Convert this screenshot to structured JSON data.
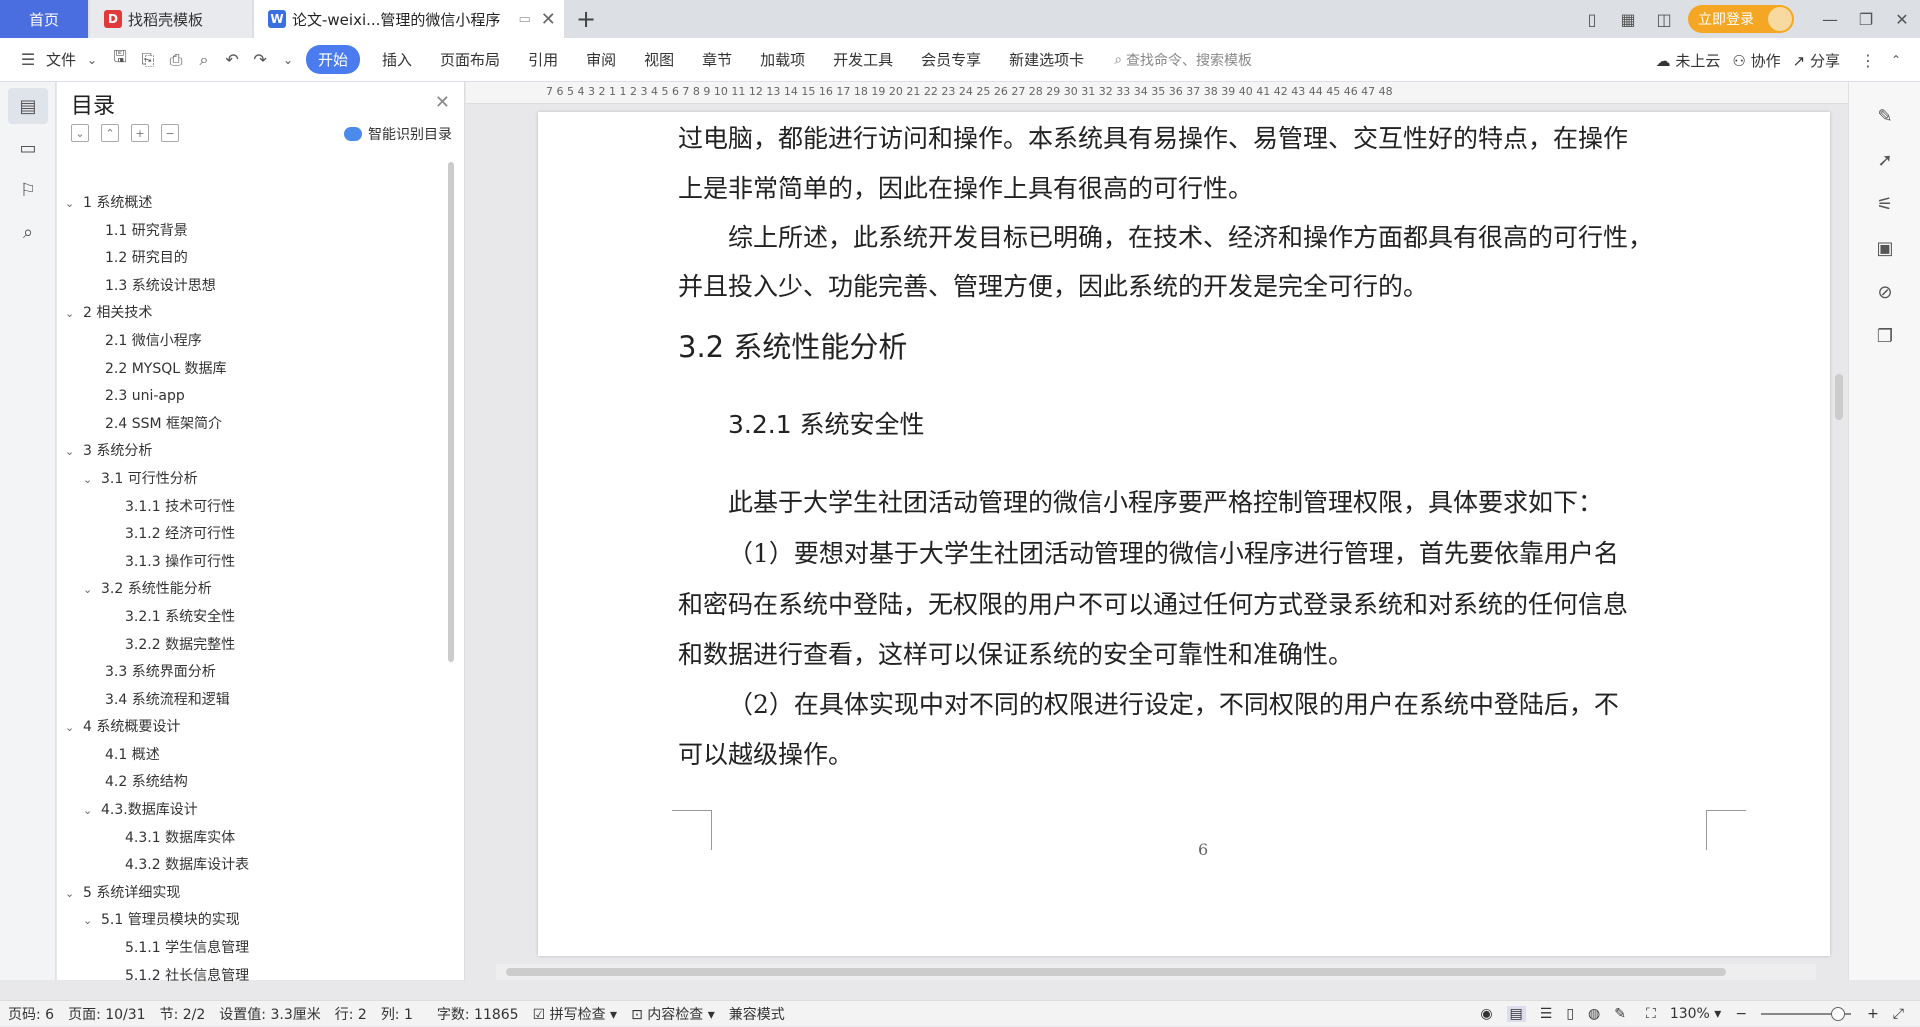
{
  "tabs": {
    "home": "首页",
    "daoke": "找稻壳模板",
    "doc": "论文-weixi...管理的微信小程序",
    "login": "立即登录"
  },
  "menu": {
    "file": "文件",
    "items": [
      "开始",
      "插入",
      "页面布局",
      "引用",
      "审阅",
      "视图",
      "章节",
      "加载项",
      "开发工具",
      "会员专享",
      "新建选项卡"
    ],
    "search_placeholder": "查找命令、搜索模板",
    "cloud": "未上云",
    "collab": "协作",
    "share": "分享"
  },
  "toc": {
    "title": "目录",
    "ai": "智能识别目录",
    "items": [
      {
        "level": 1,
        "exp": true,
        "text": "1 系统概述"
      },
      {
        "level": 2,
        "exp": false,
        "text": "1.1  研究背景"
      },
      {
        "level": 2,
        "exp": false,
        "text": "1.2 研究目的"
      },
      {
        "level": 2,
        "exp": false,
        "text": "1.3 系统设计思想"
      },
      {
        "level": 1,
        "exp": true,
        "text": "2 相关技术"
      },
      {
        "level": 2,
        "exp": false,
        "text": "2.1 微信小程序"
      },
      {
        "level": 2,
        "exp": false,
        "text": "2.2 MYSQL 数据库"
      },
      {
        "level": 2,
        "exp": false,
        "text": "2.3 uni-app"
      },
      {
        "level": 2,
        "exp": false,
        "text": "2.4 SSM 框架简介"
      },
      {
        "level": 1,
        "exp": true,
        "text": "3 系统分析"
      },
      {
        "level": 2,
        "exp": true,
        "text": "3.1 可行性分析"
      },
      {
        "level": 3,
        "exp": false,
        "text": "3.1.1 技术可行性"
      },
      {
        "level": 3,
        "exp": false,
        "text": "3.1.2 经济可行性"
      },
      {
        "level": 3,
        "exp": false,
        "text": "3.1.3 操作可行性"
      },
      {
        "level": 2,
        "exp": true,
        "text": "3.2 系统性能分析"
      },
      {
        "level": 3,
        "exp": false,
        "text": "3.2.1  系统安全性"
      },
      {
        "level": 3,
        "exp": false,
        "text": "3.2.2  数据完整性"
      },
      {
        "level": 2,
        "exp": false,
        "text": "3.3 系统界面分析"
      },
      {
        "level": 2,
        "exp": false,
        "text": "3.4 系统流程和逻辑"
      },
      {
        "level": 1,
        "exp": true,
        "text": "4 系统概要设计"
      },
      {
        "level": 2,
        "exp": false,
        "text": "4.1 概述"
      },
      {
        "level": 2,
        "exp": false,
        "text": "4.2 系统结构"
      },
      {
        "level": 2,
        "exp": true,
        "text": "4.3.数据库设计"
      },
      {
        "level": 3,
        "exp": false,
        "text": "4.3.1 数据库实体"
      },
      {
        "level": 3,
        "exp": false,
        "text": "4.3.2 数据库设计表"
      },
      {
        "level": 1,
        "exp": true,
        "text": "5 系统详细实现"
      },
      {
        "level": 2,
        "exp": true,
        "text": "5.1  管理员模块的实现"
      },
      {
        "level": 3,
        "exp": false,
        "text": "5.1.1  学生信息管理"
      },
      {
        "level": 3,
        "exp": false,
        "text": "5.1.2  社长信息管理"
      }
    ]
  },
  "ruler": "7  6  5  4  3  2  1     1  2  3  4  5  6  7  8  9  10  11  12  13  14  15  16  17  18  19  20  21  22  23  24  25  26  27  28  29  30  31  32  33  34  35  36  37  38  39  40  41  42  43  44  45  46  47  48",
  "doc": {
    "p1": "过电脑，都能进行访问和操作。本系统具有易操作、易管理、交互性好的特点，在操作",
    "p2": "上是非常简单的，因此在操作上具有很高的可行性。",
    "p3": "综上所述，此系统开发目标已明确，在技术、经济和操作方面都具有很高的可行性，",
    "p4": "并且投入少、功能完善、管理方便，因此系统的开发是完全可行的。",
    "h2": "3.2 系统性能分析",
    "h3": "3.2.1  系统安全性",
    "p5": "此基于大学生社团活动管理的微信小程序要严格控制管理权限，具体要求如下：",
    "p6": "（1）要想对基于大学生社团活动管理的微信小程序进行管理，首先要依靠用户名",
    "p7": "和密码在系统中登陆，无权限的用户不可以通过任何方式登录系统和对系统的任何信息",
    "p8": "和数据进行查看，这样可以保证系统的安全可靠性和准确性。",
    "p9": "（2）在具体实现中对不同的权限进行设定，不同权限的用户在系统中登陆后，不",
    "p10": "可以越级操作。",
    "page_num": "6"
  },
  "status": {
    "page_code": "页码: 6",
    "page": "页面: 10/31",
    "section": "节: 2/2",
    "setting": "设置值: 3.3厘米",
    "row": "行: 2",
    "col": "列: 1",
    "words": "字数: 11865",
    "spell": "拼写检查",
    "content": "内容检查",
    "compat": "兼容模式",
    "zoom": "130%"
  }
}
